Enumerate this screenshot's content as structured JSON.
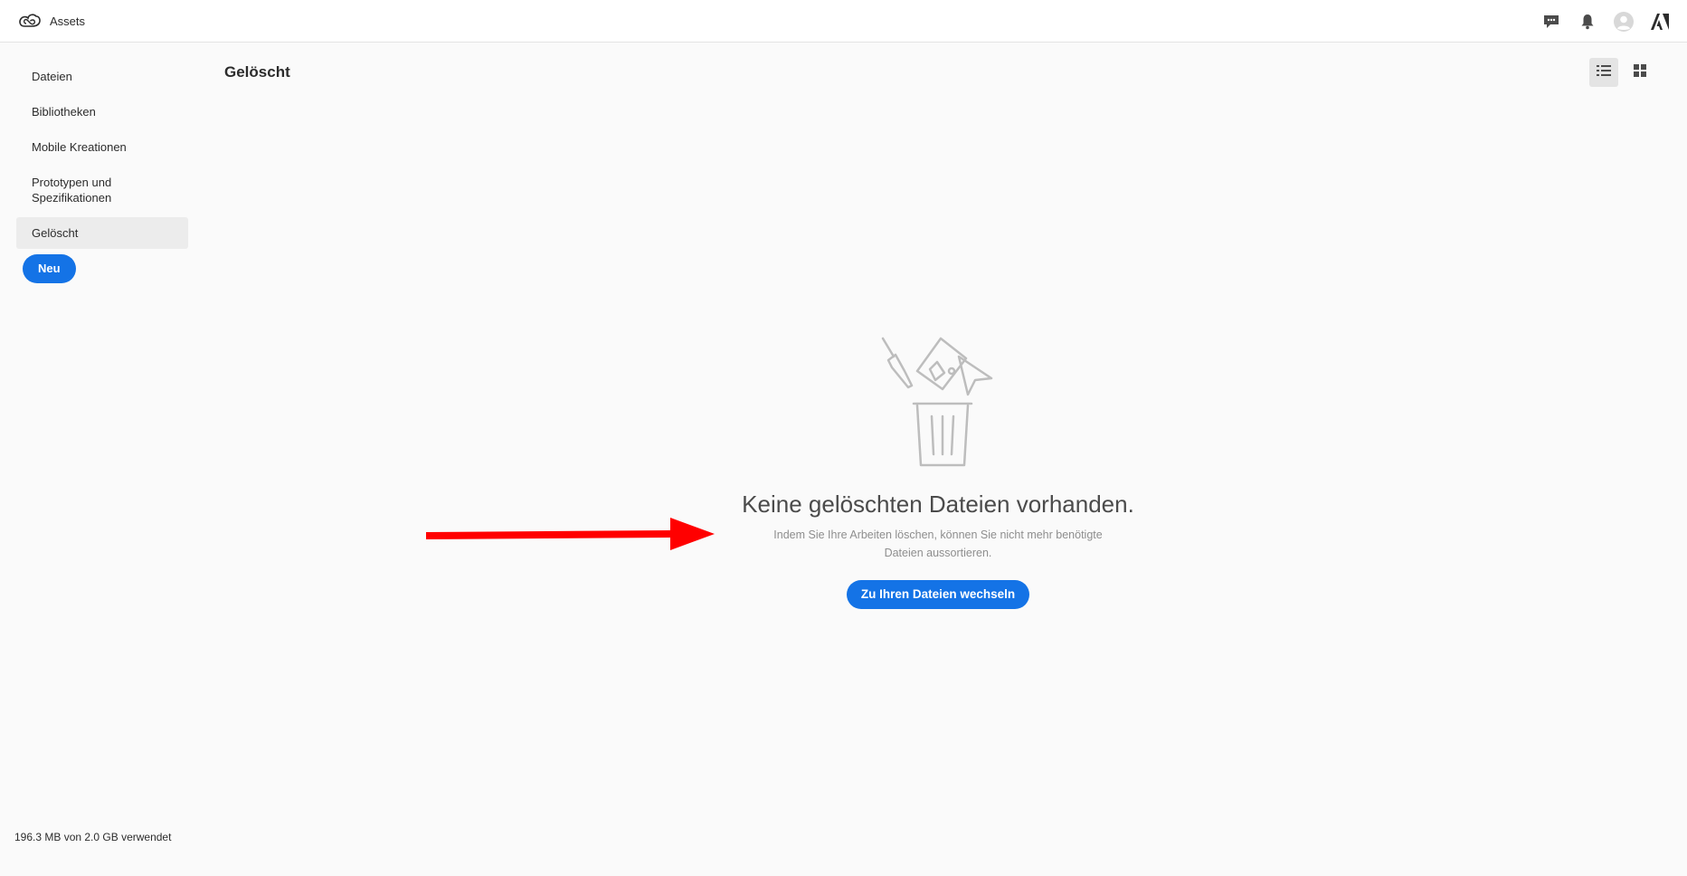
{
  "header": {
    "app_name": "Assets",
    "icons": [
      "creative-cloud-icon",
      "feedback-icon",
      "bell-icon",
      "avatar-icon",
      "adobe-icon"
    ]
  },
  "sidebar": {
    "items": [
      {
        "label": "Dateien"
      },
      {
        "label": "Bibliotheken"
      },
      {
        "label": "Mobile Kreationen"
      },
      {
        "label": "Prototypen und Spezifikationen"
      },
      {
        "label": "Gelöscht",
        "active": true
      }
    ],
    "new_button": "Neu",
    "storage": "196.3 MB von 2.0 GB verwendet"
  },
  "main": {
    "title": "Gelöscht",
    "view_modes": [
      "list-view-icon",
      "grid-view-icon"
    ],
    "active_view": "list",
    "empty_state": {
      "title": "Keine gelöschten Dateien vorhanden.",
      "description": "Indem Sie Ihre Arbeiten löschen, können Sie nicht mehr benötigte Dateien aussortieren.",
      "button": "Zu Ihren Dateien wechseln"
    }
  },
  "colors": {
    "accent": "#1473e6",
    "annotation": "#ff0000",
    "background": "#fafafa"
  }
}
